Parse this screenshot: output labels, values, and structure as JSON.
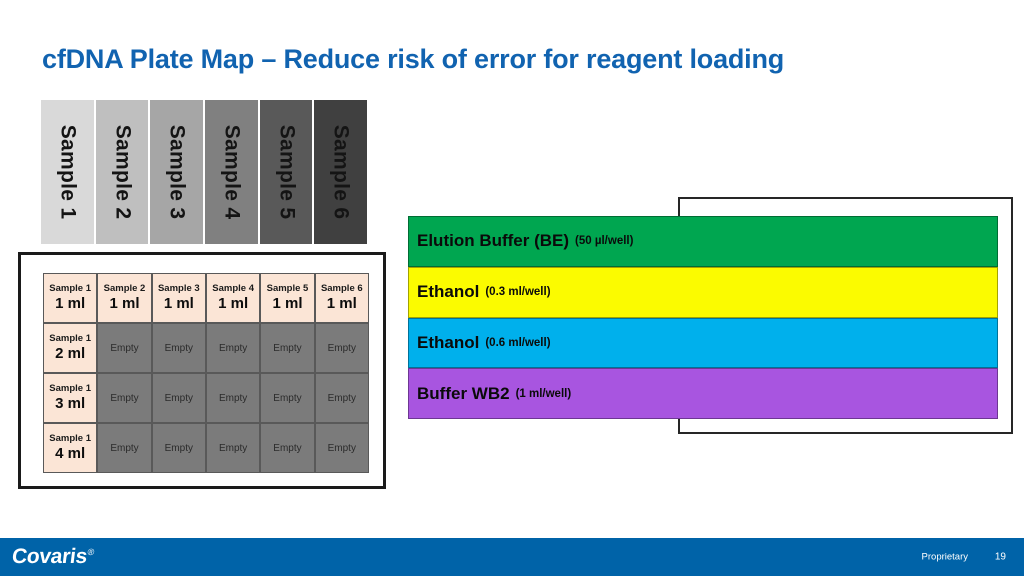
{
  "slide": {
    "title": "cfDNA Plate Map – Reduce risk of error for reagent loading",
    "title_color": "#1163b0",
    "background": "#ffffff"
  },
  "sample_header": {
    "columns": [
      {
        "label": "Sample 1",
        "fill": "#d9d9d9"
      },
      {
        "label": "Sample 2",
        "fill": "#bfbfbf"
      },
      {
        "label": "Sample 3",
        "fill": "#a6a6a6"
      },
      {
        "label": "Sample 4",
        "fill": "#808080"
      },
      {
        "label": "Sample 5",
        "fill": "#595959"
      },
      {
        "label": "Sample 6",
        "fill": "#404040"
      }
    ]
  },
  "plate": {
    "filled_color": "#fbe5d6",
    "empty_color": "#7b7b7b",
    "empty_label": "Empty",
    "rows": [
      [
        {
          "sample": "Sample 1",
          "volume": "1 ml",
          "state": "filled"
        },
        {
          "sample": "Sample 2",
          "volume": "1 ml",
          "state": "filled"
        },
        {
          "sample": "Sample 3",
          "volume": "1 ml",
          "state": "filled"
        },
        {
          "sample": "Sample 4",
          "volume": "1 ml",
          "state": "filled"
        },
        {
          "sample": "Sample 5",
          "volume": "1 ml",
          "state": "filled"
        },
        {
          "sample": "Sample 6",
          "volume": "1 ml",
          "state": "filled"
        }
      ],
      [
        {
          "sample": "Sample 1",
          "volume": "2 ml",
          "state": "filled"
        },
        {
          "sample": "",
          "volume": "Empty",
          "state": "empty"
        },
        {
          "sample": "",
          "volume": "Empty",
          "state": "empty"
        },
        {
          "sample": "",
          "volume": "Empty",
          "state": "empty"
        },
        {
          "sample": "",
          "volume": "Empty",
          "state": "empty"
        },
        {
          "sample": "",
          "volume": "Empty",
          "state": "empty"
        }
      ],
      [
        {
          "sample": "Sample 1",
          "volume": "3 ml",
          "state": "filled"
        },
        {
          "sample": "",
          "volume": "Empty",
          "state": "empty"
        },
        {
          "sample": "",
          "volume": "Empty",
          "state": "empty"
        },
        {
          "sample": "",
          "volume": "Empty",
          "state": "empty"
        },
        {
          "sample": "",
          "volume": "Empty",
          "state": "empty"
        },
        {
          "sample": "",
          "volume": "Empty",
          "state": "empty"
        }
      ],
      [
        {
          "sample": "Sample 1",
          "volume": "4 ml",
          "state": "filled"
        },
        {
          "sample": "",
          "volume": "Empty",
          "state": "empty"
        },
        {
          "sample": "",
          "volume": "Empty",
          "state": "empty"
        },
        {
          "sample": "",
          "volume": "Empty",
          "state": "empty"
        },
        {
          "sample": "",
          "volume": "Empty",
          "state": "empty"
        },
        {
          "sample": "",
          "volume": "Empty",
          "state": "empty"
        }
      ]
    ]
  },
  "reagents": {
    "bars": [
      {
        "name": "Elution Buffer (BE)",
        "amount": "(50 µl/well)",
        "color": "#00a650"
      },
      {
        "name": "Ethanol",
        "amount": "(0.3 ml/well)",
        "color": "#fbfb00"
      },
      {
        "name": "Ethanol",
        "amount": "(0.6 ml/well)",
        "color": "#00b0ec"
      },
      {
        "name": "Buffer WB2",
        "amount": "(1 ml/well)",
        "color": "#a855e0"
      }
    ]
  },
  "footer": {
    "logo": "Covaris",
    "logo_mark": "®",
    "proprietary": "Proprietary",
    "page_number": "19",
    "bar_color": "#0063a8"
  }
}
